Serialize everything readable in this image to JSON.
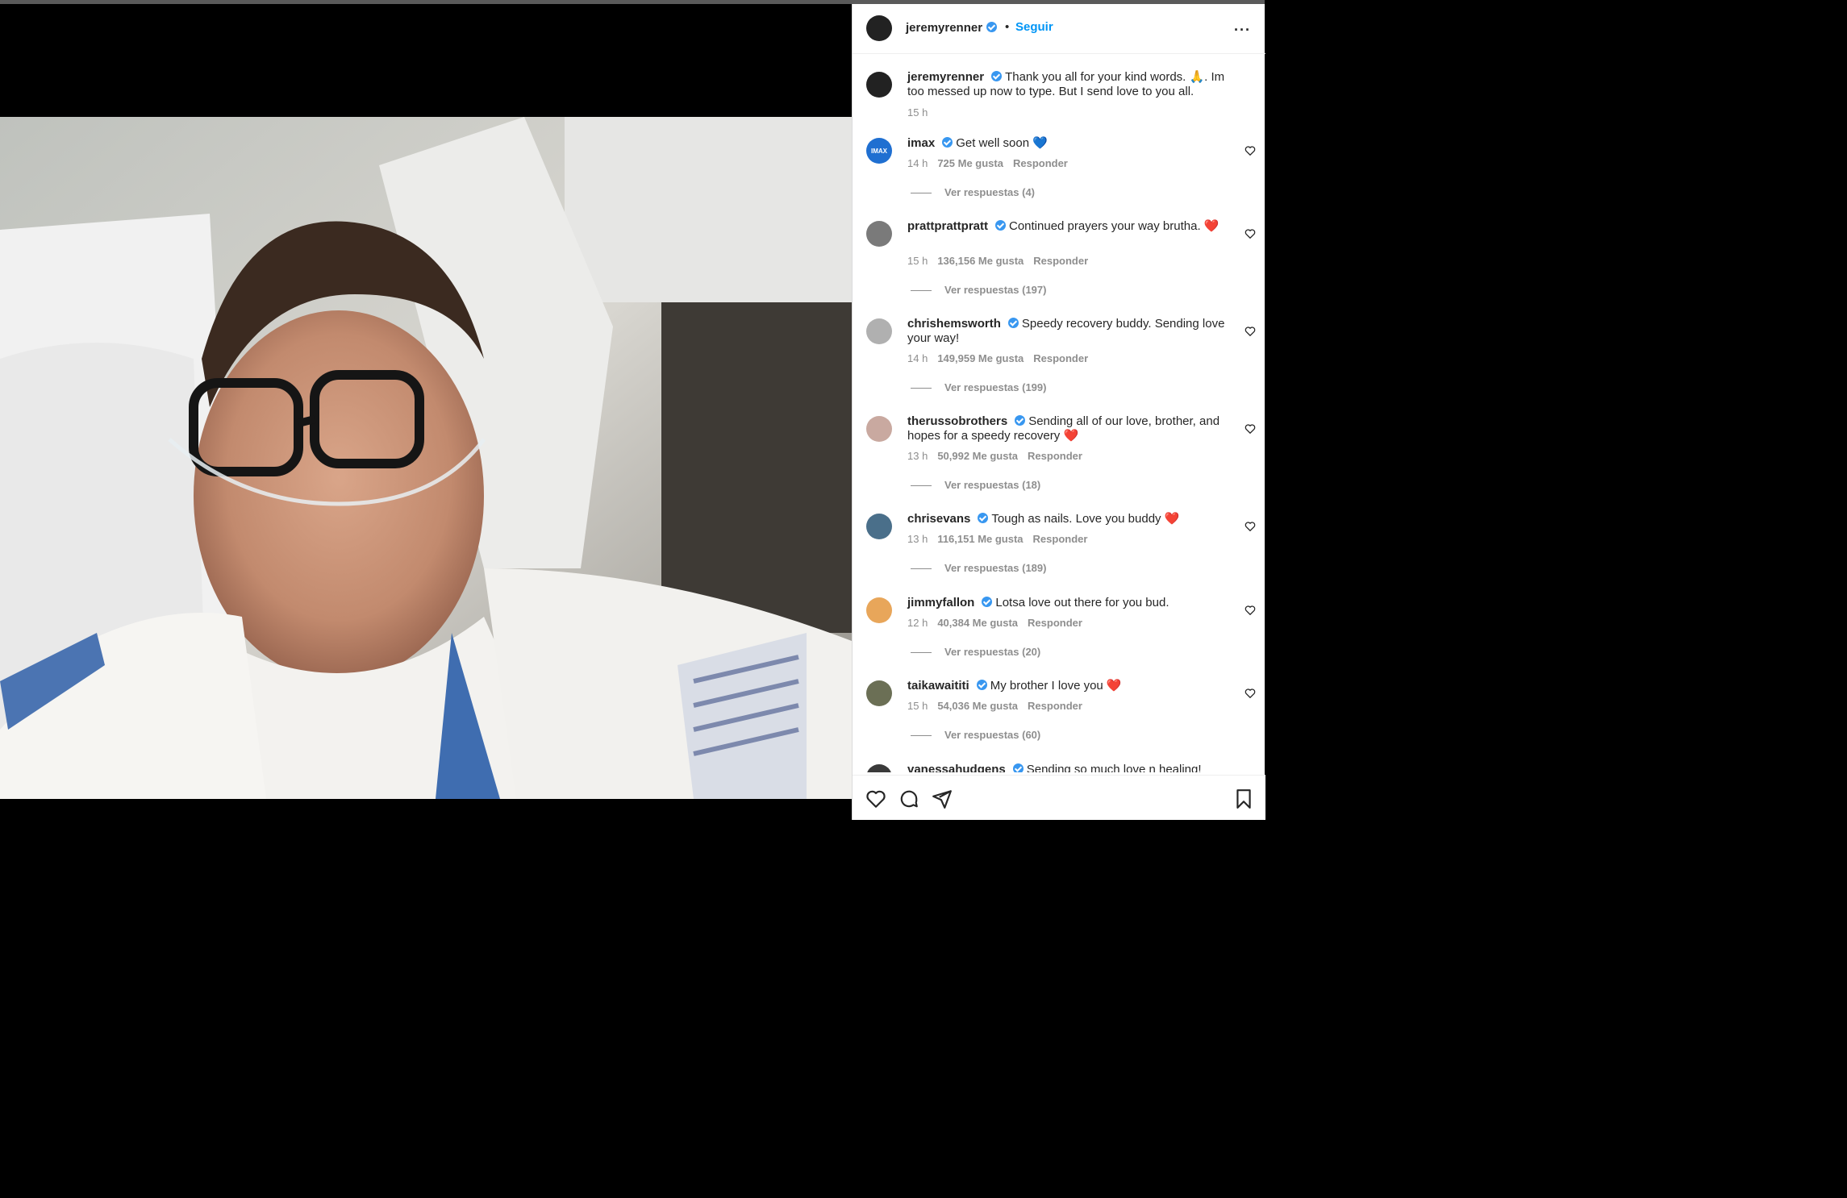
{
  "post": {
    "author": "jeremyrenner",
    "follow_label": "Seguir",
    "separator": "•",
    "more_label": "···",
    "caption": "Thank you all for your kind words. 🙏. Im too messed up now to type. But I send love to you all.",
    "caption_time": "15 h"
  },
  "comments": [
    {
      "user": "imax",
      "text": "Get well soon 💙",
      "time": "14 h",
      "likes": "725 Me gusta",
      "reply": "Responder",
      "replies": "Ver respuestas (4)",
      "avatar_color": "#1f6fd1"
    },
    {
      "user": "prattprattpratt",
      "text": "Continued prayers your way brutha. ❤️",
      "time": "15 h",
      "likes": "136,156 Me gusta",
      "reply": "Responder",
      "replies": "Ver respuestas (197)",
      "avatar_color": "#7a7a7a"
    },
    {
      "user": "chrishemsworth",
      "text": "Speedy recovery buddy. Sending love your way!",
      "time": "14 h",
      "likes": "149,959 Me gusta",
      "reply": "Responder",
      "replies": "Ver respuestas (199)",
      "avatar_color": "#b0b0b0"
    },
    {
      "user": "therussobrothers",
      "text": "Sending all of our love, brother, and hopes for a speedy recovery ❤️",
      "time": "13 h",
      "likes": "50,992 Me gusta",
      "reply": "Responder",
      "replies": "Ver respuestas (18)",
      "avatar_color": "#c9a9a0"
    },
    {
      "user": "chrisevans",
      "text": "Tough as nails. Love you buddy ❤️",
      "time": "13 h",
      "likes": "116,151 Me gusta",
      "reply": "Responder",
      "replies": "Ver respuestas (189)",
      "avatar_color": "#4a6f8a"
    },
    {
      "user": "jimmyfallon",
      "text": "Lotsa love out there for you bud.",
      "time": "12 h",
      "likes": "40,384 Me gusta",
      "reply": "Responder",
      "replies": "Ver respuestas (20)",
      "avatar_color": "#e8a65a"
    },
    {
      "user": "taikawaititi",
      "text": "My brother I love you ❤️",
      "time": "15 h",
      "likes": "54,036 Me gusta",
      "reply": "Responder",
      "replies": "Ver respuestas (60)",
      "avatar_color": "#6b6f55"
    },
    {
      "user": "vanessahudgens",
      "text": "Sending so much love n healing!",
      "time": "",
      "likes": "",
      "reply": "",
      "replies": "",
      "avatar_color": "#3a3a3a"
    }
  ],
  "icons": {
    "like": "heart-icon",
    "comment": "comment-icon",
    "share": "send-icon",
    "save": "bookmark-icon",
    "imax_avatar_text": "IMAX"
  },
  "colors": {
    "accent": "#0095f6",
    "verified": "#3897f0",
    "muted": "#8e8e8e"
  }
}
